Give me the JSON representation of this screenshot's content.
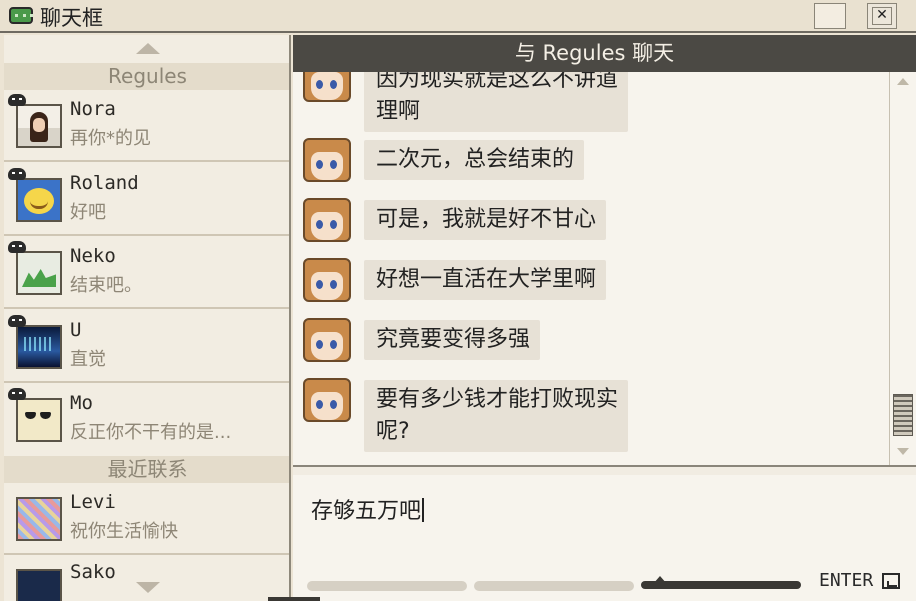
{
  "window": {
    "title": "聊天框",
    "icon": "chat-bubble-icon"
  },
  "contacts_panel": {
    "favorites_group": "Regules",
    "favorites": [
      {
        "name": "Nora",
        "message": "再你*的见",
        "avatar": "girl-avatar"
      },
      {
        "name": "Roland",
        "message": "好吧",
        "avatar": "smiley-avatar"
      },
      {
        "name": "Neko",
        "message": "结束吧。",
        "avatar": "frog-avatar"
      },
      {
        "name": "U",
        "message": "直觉",
        "avatar": "aurora-avatar"
      },
      {
        "name": "Mo",
        "message": "反正你不干有的是...",
        "avatar": "sunglasses-avatar"
      }
    ],
    "recent_group": "最近联系",
    "recent": [
      {
        "name": "Levi",
        "message": "祝你生活愉快",
        "avatar": "mosaic-avatar"
      },
      {
        "name": "Sako",
        "message": "",
        "avatar": "dark-avatar"
      }
    ]
  },
  "chat": {
    "header": "与 Regules 聊天",
    "messages": [
      {
        "line1": "因为现实就是这么不讲道",
        "line2": "理啊"
      },
      {
        "line1": "二次元，总会结束的"
      },
      {
        "line1": "可是，我就是好不甘心"
      },
      {
        "line1": "好想一直活在大学里啊"
      },
      {
        "line1": "究竟要变得多强"
      },
      {
        "line1": "要有多少钱才能打败现实",
        "line2": "呢?"
      }
    ],
    "input_value": "存够五万吧",
    "send_label": "ENTER",
    "send_icon": "return-key-icon"
  },
  "colors": {
    "header_bg": "#4b4944",
    "bubble_bg": "#e7e1d6",
    "group_header_bg": "#e4dccb"
  }
}
